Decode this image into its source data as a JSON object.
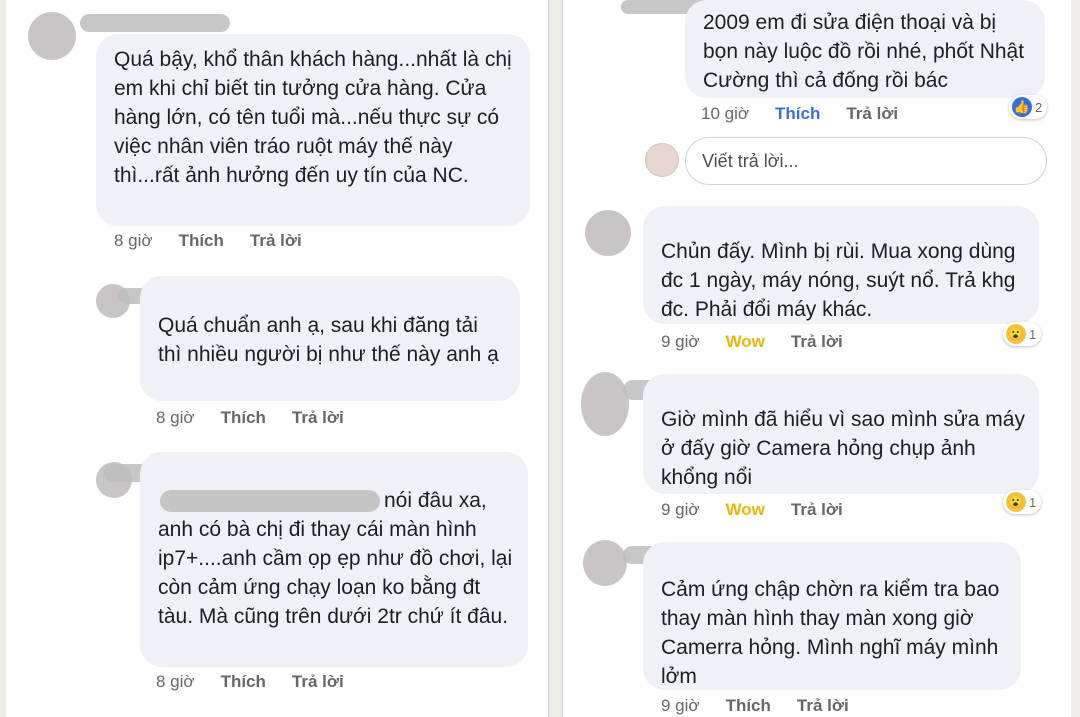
{
  "left": {
    "comments": [
      {
        "text": "Quá bậy, khổ thân khách hàng...nhất là chị em khi chỉ biết tin tưởng cửa hàng. Cửa hàng lớn, có tên tuổi mà...nếu thực sự có việc nhân viên tráo ruột máy thế này thì...rất ảnh hưởng đến uy tín của NC.",
        "time": "8 giờ",
        "action": "Thích",
        "reply": "Trả lời"
      },
      {
        "text": "Quá chuẩn anh ạ, sau khi đăng tải thì nhiều người bị như thế này anh ạ",
        "time": "8 giờ",
        "action": "Thích",
        "reply": "Trả lời"
      },
      {
        "text_visible": "nói đâu xa,",
        "text_rest": "anh có bà chị đi thay cái màn hình ip7+....anh cầm ọp ẹp như đồ chơi, lại còn cảm ứng chạy loạn ko bằng đt tàu. Mà cũng trên dưới 2tr chứ ít đâu.",
        "time": "8 giờ",
        "action": "Thích",
        "reply": "Trả lời"
      }
    ]
  },
  "right": {
    "comments": [
      {
        "text": "2009 em đi sửa điện thoại và bị bọn này luộc đồ rồi nhé, phốt Nhật Cường thì cả đống rồi bác",
        "time": "10 giờ",
        "action": "Thích",
        "reply": "Trả lời",
        "reaction": {
          "icon": "like-icon",
          "count": "2"
        }
      },
      {
        "text": "Chủn đấy. Mình bị rùi. Mua xong dùng đc 1 ngày, máy nóng, suýt nổ. Trả khg đc. Phải đổi máy khác.",
        "time": "9 giờ",
        "action": "Wow",
        "reply": "Trả lời",
        "reaction": {
          "icon": "wow-icon",
          "count": "1"
        }
      },
      {
        "text": "Giờ mình đã hiểu vì sao mình sửa máy ở đấy giờ Camera hỏng chụp ảnh khổng nổi",
        "time": "9 giờ",
        "action": "Wow",
        "reply": "Trả lời",
        "reaction": {
          "icon": "wow-icon",
          "count": "1"
        }
      },
      {
        "text": "Cảm ứng chập chờn ra kiểm tra bao thay màn hình thay màn xong giờ Camerra hỏng. Mình nghĩ máy mình lởm",
        "time": "9 giờ",
        "action": "Thích",
        "reply": "Trả lời"
      }
    ],
    "reply_placeholder": "Viết trả lời..."
  },
  "colors": {
    "bubble": "#f0f1f6",
    "link_blue": "#3b6fd8",
    "wow_yellow": "#e8b800",
    "meta_gray": "#65676b"
  }
}
